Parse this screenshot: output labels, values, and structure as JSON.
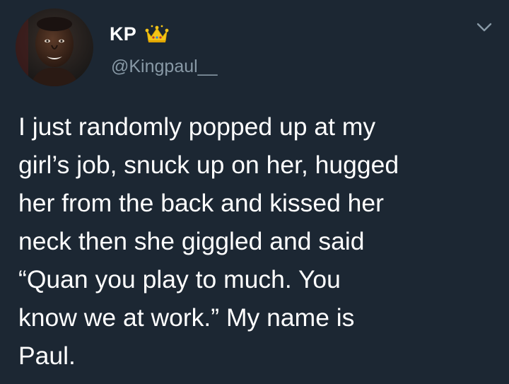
{
  "author": {
    "display_name": "KP",
    "handle": "@Kingpaul__",
    "badge_icon": "crown-icon",
    "avatar_icon": "profile-photo"
  },
  "menu": {
    "icon": "chevron-down-icon"
  },
  "tweet": {
    "text": "I just randomly popped up at my\ngirl’s job, snuck up on her, hugged\nher from the back and kissed her\nneck then she giggled and said\n“Quan you play to much. You\nknow we at work.” My name is\nPaul."
  },
  "colors": {
    "background": "#1c2733",
    "text": "#ffffff",
    "secondary_text": "#8899a6",
    "crown": "#f5c518"
  }
}
